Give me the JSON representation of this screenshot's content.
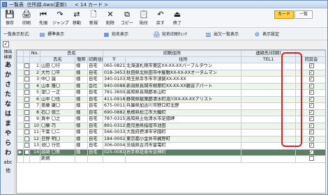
{
  "window": {
    "title": "一覧表  住所録.Awa(更新)     < 14 カード >"
  },
  "toolbar": {
    "buttons": [
      {
        "label": "保存",
        "icon": "save-icon",
        "glyph": "💾"
      },
      {
        "label": "印刷",
        "icon": "print-icon",
        "glyph": "🖨"
      },
      {
        "label": "先頭",
        "icon": "first-icon",
        "glyph": "⏮"
      },
      {
        "label": "ジャンプ",
        "icon": "jump-icon",
        "glyph": "↷"
      },
      {
        "label": "移動",
        "icon": "move-icon",
        "glyph": "⇄"
      },
      {
        "label": "新規",
        "icon": "new-icon",
        "glyph": "🗋"
      },
      {
        "label": "削除",
        "icon": "delete-icon",
        "glyph": "✕"
      },
      {
        "label": "コピー",
        "icon": "copy-icon",
        "glyph": "⧉"
      },
      {
        "label": "貼付",
        "icon": "paste-icon",
        "glyph": "📋"
      },
      {
        "label": "戻す",
        "icon": "undo-icon",
        "glyph": "↶"
      },
      {
        "label": "終了",
        "icon": "exit-icon",
        "glyph": "⏏"
      }
    ],
    "card_label": "カード",
    "list_label": "一覧"
  },
  "subbar": {
    "label": "一覧表示形式:",
    "items": [
      {
        "label": "標準表示",
        "icon": "standard-view-icon",
        "glyph": "▤"
      },
      {
        "label": "宛名表示",
        "icon": "address-view-icon",
        "glyph": "▦"
      },
      {
        "label": "宛名印刷ﾁｪｯｸ",
        "icon": "print-check-icon",
        "glyph": "🖨"
      },
      {
        "label": "出欠一覧表示",
        "icon": "attendance-icon",
        "glyph": "▥"
      },
      {
        "label": "表示設定",
        "icon": "settings-icon",
        "glyph": "⚙"
      }
    ]
  },
  "side": {
    "header1": "抽出",
    "header2": "検索",
    "kana": [
      "あ",
      "か",
      "さ",
      "た",
      "な",
      "は",
      "ま",
      "や",
      "ら",
      "わ"
    ],
    "extra": [
      "abc",
      "他"
    ]
  },
  "table": {
    "header_top": {
      "no": "No.",
      "name": "氏名",
      "print": "印刷住所",
      "contact": "連絡先(印刷)"
    },
    "header_bottom": {
      "name": "氏名",
      "title": "敬称",
      "print_addr": "印刷住所",
      "zip": "〒",
      "address": "住所",
      "tel": "TEL1",
      "attend": "同窓会"
    },
    "rows": [
      {
        "no": "1",
        "name": "山田 〇行",
        "title": "様",
        "addr_type": "自宅",
        "zip": "065-0821",
        "address": "北海道札幌市東区XX-XX-XXパープルタウン",
        "attend": true
      },
      {
        "no": "2",
        "name": "大竹 〇平",
        "title": "様",
        "addr_type": "自宅",
        "zip": "018-3453",
        "address": "秋田県北秋田市中屋敷XX-XX-XXオータムマン",
        "attend": true
      },
      {
        "no": "3",
        "name": "中〇 誠",
        "title": "様",
        "addr_type": "自宅",
        "zip": "340-0103",
        "address": "埼玉県幸手市平須賀XX-XX-XX",
        "attend": true
      },
      {
        "no": "4",
        "name": "山本 隆〇",
        "title": "様",
        "addr_type": "会社",
        "zip": "940-0088",
        "address": "新潟県長岡市柳原町XX-XX-XX観音アパート",
        "attend": true
      },
      {
        "no": "5",
        "name": "望〇 一正",
        "title": "様",
        "addr_type": "自宅",
        "zip": "781-3600",
        "address": "高知県長岡郡本山町",
        "attend": true
      },
      {
        "no": "6",
        "name": "山中 〇也",
        "title": "様",
        "addr_type": "自宅",
        "zip": "411-0918",
        "address": "静岡県駿東郡清水町湯川XX-XX-XXアリスト",
        "attend": true
      },
      {
        "no": "7",
        "name": "斎藤 康〇",
        "title": "様",
        "addr_type": "自宅",
        "zip": "675-0011",
        "address": "兵庫県加古川市野口町北野",
        "attend": true
      },
      {
        "no": "8",
        "name": "石〇 徳三",
        "title": "様",
        "addr_type": "自宅",
        "zip": "690-0882",
        "address": "島根県松江市大輪町",
        "attend": true
      },
      {
        "no": "9",
        "name": "真中 〇之",
        "title": "様",
        "addr_type": "自宅",
        "zip": "787-0315",
        "address": "高知県土佐清水市足摺岬",
        "attend": true
      },
      {
        "no": "10",
        "name": "〇藤 巧",
        "title": "様",
        "addr_type": "自宅",
        "zip": "891-0312",
        "address": "鹿児島県指宿市池田",
        "attend": true
      },
      {
        "no": "11",
        "name": "千葉 〇二",
        "title": "様",
        "addr_type": "自宅",
        "zip": "566-0033",
        "address": "大阪府摂津市学園町",
        "attend": true
      },
      {
        "no": "12",
        "name": "日野 明〇",
        "title": "様",
        "addr_type": "自宅",
        "zip": "184-0002",
        "address": "東京都小金井市梶野町",
        "attend": true
      },
      {
        "no": "13",
        "name": "池〇 行信",
        "title": "様",
        "addr_type": "自宅",
        "zip": "306-0004",
        "address": "茨城県古河市雷電町",
        "attend": true
      },
      {
        "no": "14",
        "name": "高崎 〇男",
        "title": "様",
        "addr_type": "自宅",
        "zip": "025-0081",
        "address": "岩手県花巻市台神町",
        "attend": true,
        "selected": true
      },
      {
        "no": "",
        "name": "新規",
        "title": "",
        "addr_type": "",
        "zip": "",
        "address": "",
        "attend": false,
        "new": true
      }
    ]
  }
}
